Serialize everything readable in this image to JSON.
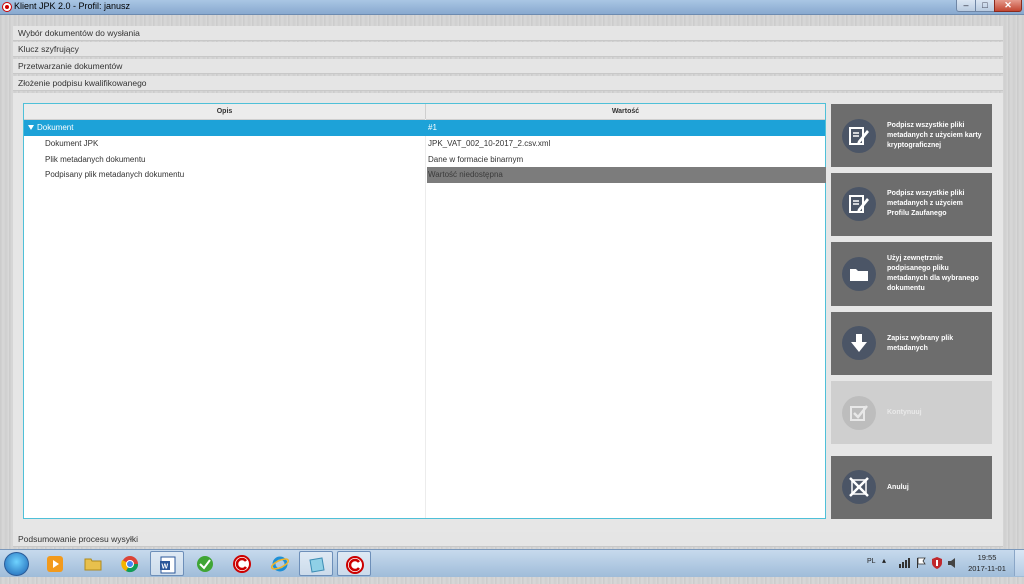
{
  "window": {
    "title": "Klient JPK 2.0 - Profil: janusz"
  },
  "steps": {
    "s1": "Wybór dokumentów do wysłania",
    "s2": "Klucz szyfrujący",
    "s3": "Przetwarzanie dokumentów",
    "s4": "Złożenie podpisu kwalifikowanego",
    "s5": "Podsumowanie procesu wysyłki"
  },
  "table": {
    "col_desc": "Opis",
    "col_value": "Wartość",
    "rows": [
      {
        "key": "Dokument",
        "value": "#1"
      },
      {
        "key": "Dokument JPK",
        "value": "JPK_VAT_002_10-2017_2.csv.xml"
      },
      {
        "key": "Plik metadanych dokumentu",
        "value": "Dane w formacie binarnym"
      },
      {
        "key": "Podpisany plik metadanych dokumentu",
        "value": "Wartość niedostępna"
      }
    ]
  },
  "actions": {
    "sign_card": "Podpisz wszystkie pliki metadanych z użyciem karty kryptograficznej",
    "sign_profile": "Podpisz wszystkie pliki metadanych z użyciem Profilu Zaufanego",
    "use_external": "Użyj zewnętrznie podpisanego pliku metadanych dla wybranego dokumentu",
    "save_file": "Zapisz wybrany plik metadanych",
    "continue": "Kontynuuj",
    "cancel": "Anuluj"
  },
  "taskbar": {
    "lang": "PL",
    "time": "19:55",
    "date": "2017-11-01"
  },
  "colors": {
    "accent": "#1da2d8",
    "button": "#6d6d6d",
    "icon_circle": "#4b5566"
  }
}
